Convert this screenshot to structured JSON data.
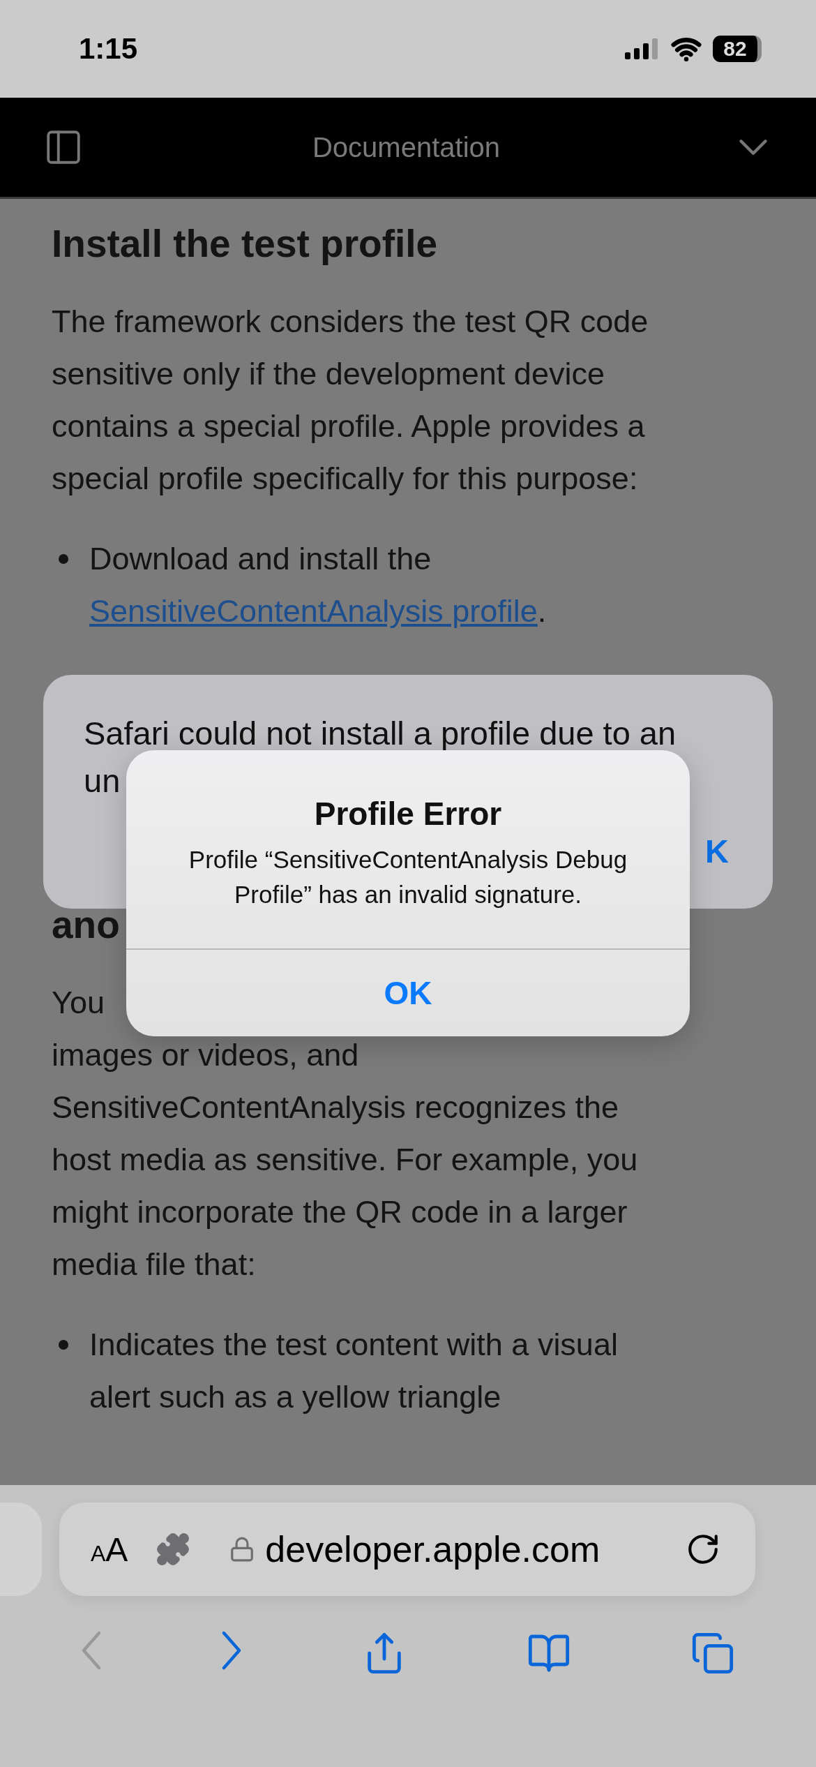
{
  "status_bar": {
    "time": "1:15",
    "battery": "82"
  },
  "nav_bar": {
    "title": "Documentation"
  },
  "article": {
    "heading": "Install the test profile",
    "paragraph": [
      "The framework considers the test QR code",
      "sensitive only if the development device",
      "contains a special profile. Apple provides a",
      "special profile specifically for this purpose:"
    ],
    "bullet": {
      "text": "Download and install the",
      "link": "SensitiveContentAnalysis profile",
      "after": "."
    },
    "heading_2": "ano",
    "paragraph_2": [
      "You",
      "images or videos, and",
      "SensitiveContentAnalysis recognizes the",
      "host media as sensitive. For example, you",
      "might incorporate the QR code in a larger",
      "media file that:"
    ],
    "bullets_2": [
      "Indicates the test content with a visual alert such as a yellow triangle"
    ]
  },
  "back_alert": {
    "lines": [
      "Safari could not install a profile due to an",
      "un"
    ],
    "button": "K"
  },
  "alert": {
    "title": "Profile Error",
    "message": "Profile “SensitiveContentAnalysis Debug Profile” has an invalid signature.",
    "button": "OK"
  },
  "address_bar": {
    "format_small": "A",
    "format_large": "A",
    "url": "developer.apple.com"
  },
  "toolbar": [
    {
      "kind": "back",
      "disabled": true
    },
    {
      "kind": "forward",
      "disabled": false
    },
    {
      "kind": "share",
      "disabled": false
    },
    {
      "kind": "bookmarks",
      "disabled": false
    },
    {
      "kind": "tabs",
      "disabled": false
    }
  ]
}
